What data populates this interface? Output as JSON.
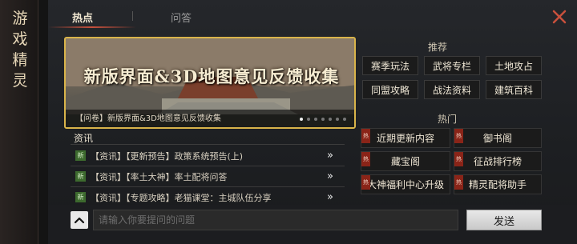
{
  "sidebar": {
    "title_chars": [
      "游",
      "戏",
      "精",
      "灵"
    ]
  },
  "tabs": [
    {
      "label": "热点"
    },
    {
      "label": "问答"
    }
  ],
  "banner": {
    "title": "新版界面&3D地图意见反馈收集",
    "caption": "【问卷】新版界面&3D地图意见反馈收集",
    "dots_total": 7,
    "active_dot": 0
  },
  "recommend": {
    "title": "推荐",
    "items": [
      "赛季玩法",
      "武将专栏",
      "土地攻占",
      "同盟攻略",
      "战法资料",
      "建筑百科"
    ]
  },
  "hot": {
    "title": "热门",
    "tag": "热",
    "items": [
      "近期更新内容",
      "御书阁",
      "藏宝阁",
      "征战排行榜",
      "大神福利中心升级",
      "精灵配将助手"
    ]
  },
  "news": {
    "title": "资讯",
    "new_tag": "新",
    "items": [
      "【资讯】【更新预告】政策系统预告(上)",
      "【资讯】【率土大神】率土配将问答",
      "【资讯】【专题攻略】老猫课堂：主城队伍分享"
    ],
    "arrow": "»"
  },
  "input": {
    "placeholder": "请输入你要提问的问题"
  },
  "send": {
    "label": "发送"
  }
}
